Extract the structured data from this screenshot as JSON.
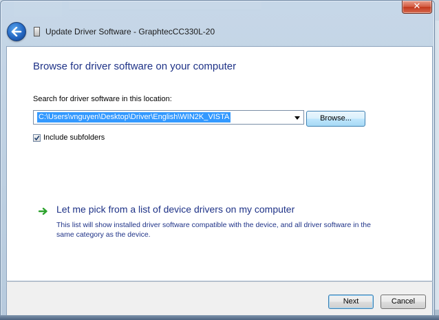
{
  "window": {
    "title": "Update Driver Software - GraphtecCC330L-20",
    "close_glyph": "✕"
  },
  "heading": "Browse for driver software on your computer",
  "search": {
    "label": "Search for driver software in this location:",
    "path_value": "C:\\Users\\vnguyen\\Desktop\\Driver\\English\\WIN2K_VISTA",
    "browse_label": "Browse..."
  },
  "include_subfolders": {
    "label": "Include subfolders",
    "checked": true
  },
  "pick_option": {
    "title": "Let me pick from a list of device drivers on my computer",
    "description": "This list will show installed driver software compatible with the device, and all driver software in the same category as the device."
  },
  "footer": {
    "next_label": "Next",
    "cancel_label": "Cancel"
  },
  "colors": {
    "link_blue": "#1e3287",
    "selection_blue": "#3399ff",
    "green_arrow": "#2ea32e",
    "close_red": "#c2381d"
  },
  "icons": {
    "back": "back-arrow-icon",
    "device": "device-icon",
    "combo": "chevron-down-icon",
    "pick": "green-arrow-icon"
  }
}
